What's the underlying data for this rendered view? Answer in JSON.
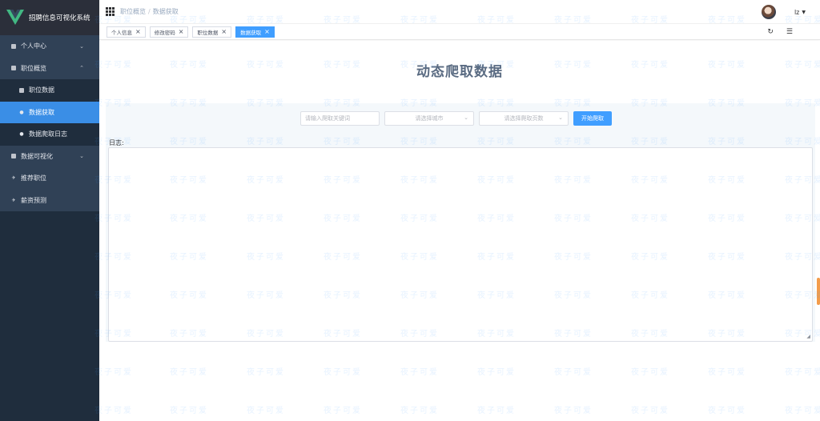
{
  "app": {
    "title": "招聘信息可视化系统"
  },
  "sidebar": {
    "items": [
      {
        "label": "个人中心",
        "arrow": "⌄"
      },
      {
        "label": "职位概览",
        "arrow": "⌃",
        "children": [
          {
            "label": "职位数据"
          },
          {
            "label": "数据获取"
          },
          {
            "label": "数据爬取日志"
          }
        ]
      },
      {
        "label": "数据可视化",
        "arrow": "⌄"
      },
      {
        "label": "推荐职位"
      },
      {
        "label": "薪资预测"
      }
    ]
  },
  "header": {
    "breadcrumb": [
      "职位概览",
      "数据获取"
    ],
    "breadcrumb_sep": "/",
    "user": "lz"
  },
  "tags": [
    {
      "label": "个人信息"
    },
    {
      "label": "修改密码"
    },
    {
      "label": "职位数据"
    },
    {
      "label": "数据获取"
    }
  ],
  "main": {
    "title": "动态爬取数据",
    "keyword_placeholder": "请输入爬取关键词",
    "city_placeholder": "请选择城市",
    "pages_placeholder": "请选择爬取页数",
    "start_button": "开始爬取",
    "log_label": "日志:"
  },
  "watermark": "夜子可爱",
  "colors": {
    "primary": "#409eff",
    "sidebar_bg": "#304156",
    "sidebar_dark": "#1f2d3d",
    "title": "#5a6b82"
  }
}
